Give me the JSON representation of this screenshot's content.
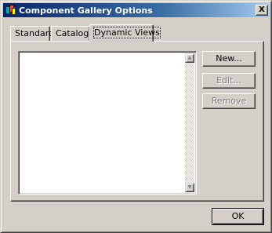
{
  "window": {
    "title": "Component Gallery Options",
    "close_label": "X"
  },
  "tabs": [
    {
      "label": "Standard"
    },
    {
      "label": "Catalogs"
    },
    {
      "label": "Dynamic Views"
    }
  ],
  "list": {
    "scroll_up": "▲",
    "scroll_down": "▼"
  },
  "buttons": {
    "new": "New...",
    "edit": "Edit...",
    "remove": "Remove",
    "ok": "OK"
  }
}
